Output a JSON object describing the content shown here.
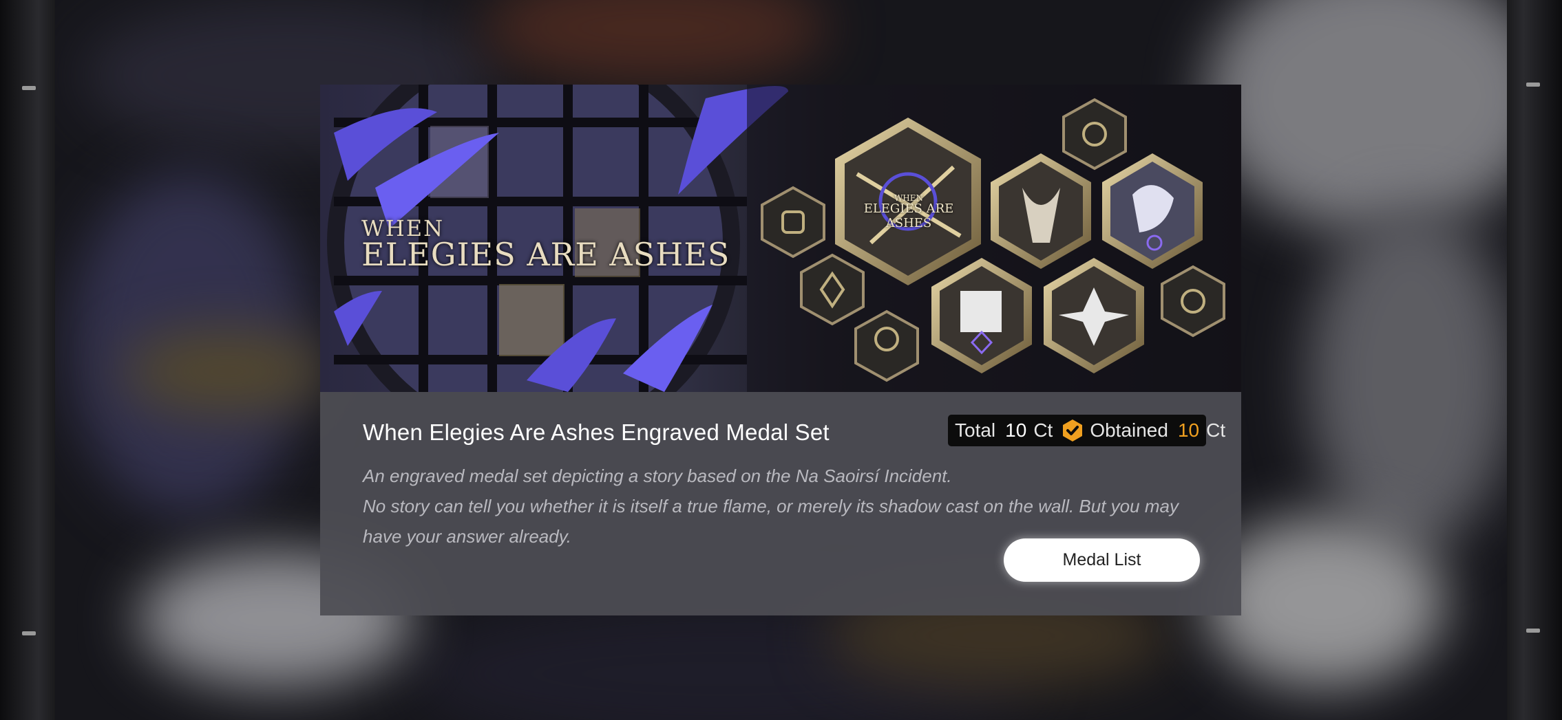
{
  "banner": {
    "logo_line1": "WHEN",
    "logo_line2": "ELEGIES ARE ASHES",
    "medal_logo_line1": "WHEN",
    "medal_logo_line2": "ELEGIES ARE ASHES"
  },
  "medal_set": {
    "title": "When Elegies Are Ashes Engraved Medal Set",
    "total_label": "Total",
    "total_count": "10",
    "total_unit": "Ct",
    "obtained_label": "Obtained",
    "obtained_count": "10",
    "obtained_unit": "Ct",
    "description_line1": "An engraved medal set depicting a story based on the Na Saoirsí Incident.",
    "description_line2": "No story can tell you whether it is itself a true flame, or merely its shadow cast on the wall. But you may have your answer already."
  },
  "buttons": {
    "medal_list": "Medal List"
  },
  "colors": {
    "accent_orange": "#f0a020",
    "panel_bg": "#4e4e54",
    "banner_purple": "#5a4fd8",
    "gold": "#c9b48a"
  },
  "icons": {
    "obtained_badge": "hexagon-check-icon"
  }
}
